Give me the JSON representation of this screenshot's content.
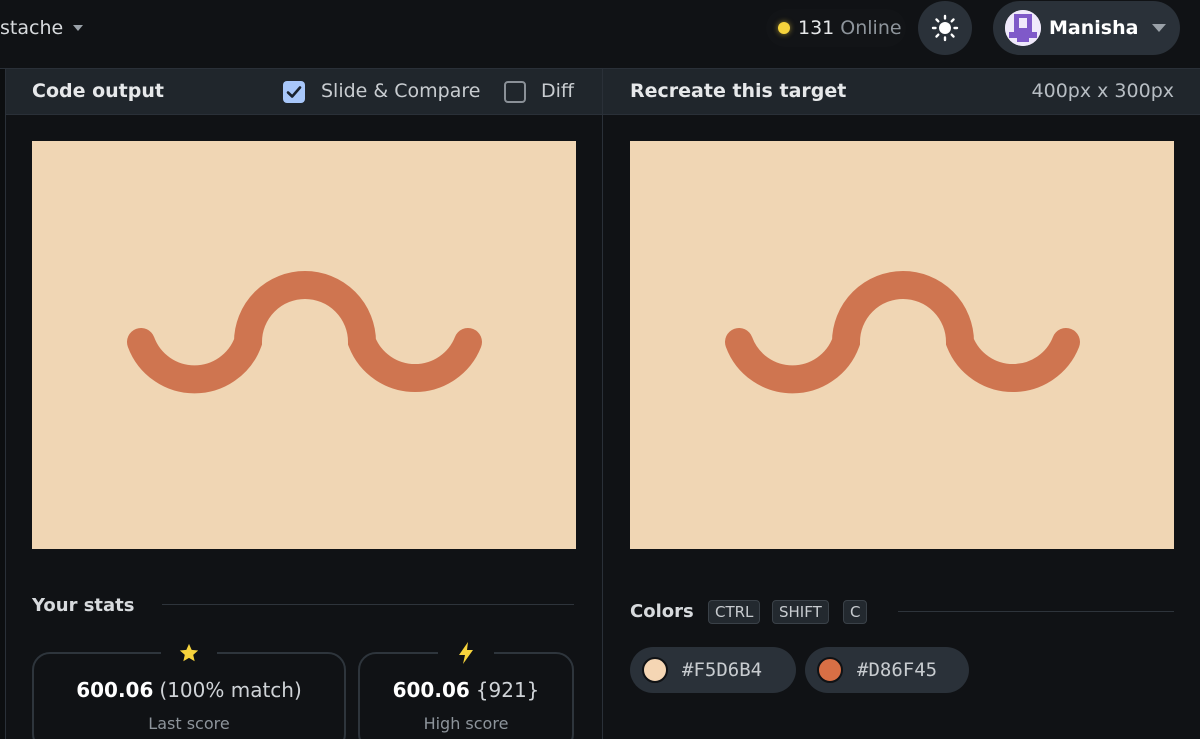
{
  "header": {
    "challenge_name": "stache",
    "online_count": "131",
    "online_label": "Online",
    "user_name": "Manisha"
  },
  "left_panel": {
    "title": "Code output",
    "slide_compare_label": "Slide & Compare",
    "slide_compare_checked": true,
    "diff_label": "Diff",
    "diff_checked": false
  },
  "right_panel": {
    "title": "Recreate this target",
    "dimensions": "400px x 300px"
  },
  "stats": {
    "title": "Your stats",
    "last": {
      "value": "600.06",
      "extra": "(100% match)",
      "label": "Last score",
      "icon": "star-icon"
    },
    "high": {
      "value": "600.06",
      "extra": "{921}",
      "label": "High score",
      "icon": "lightning-icon"
    }
  },
  "colors": {
    "title": "Colors",
    "shortcut_keys": [
      "CTRL",
      "SHIFT",
      "C"
    ],
    "swatches": [
      {
        "hex": "#F5D6B4"
      },
      {
        "hex": "#D86F45"
      }
    ]
  },
  "palette": {
    "canvas_bg": "#f0d6b4",
    "stroke": "#cf7550",
    "check_on": "#a8c7fa",
    "online_dot": "#f6d33c"
  }
}
